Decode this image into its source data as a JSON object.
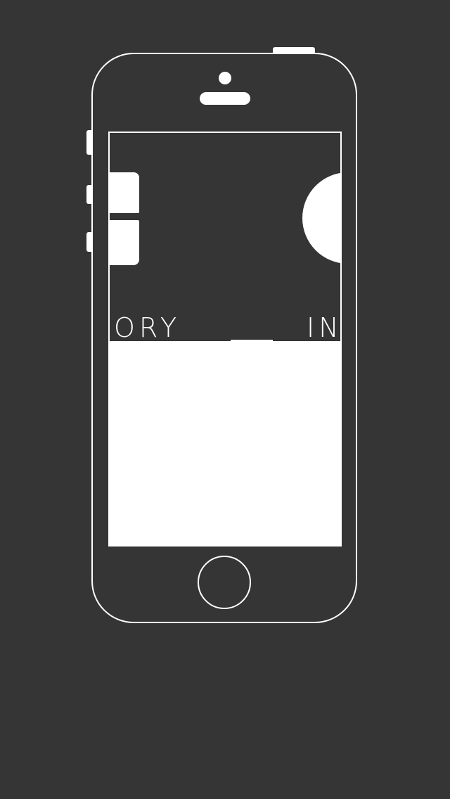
{
  "colors": {
    "background": "#353535",
    "outline": "#ffffff",
    "panel": "#ffffff"
  },
  "device": {
    "model_icon": "smartphone-outline-icon"
  },
  "carousel": {
    "left_label": "ORY",
    "right_label": "IN"
  }
}
